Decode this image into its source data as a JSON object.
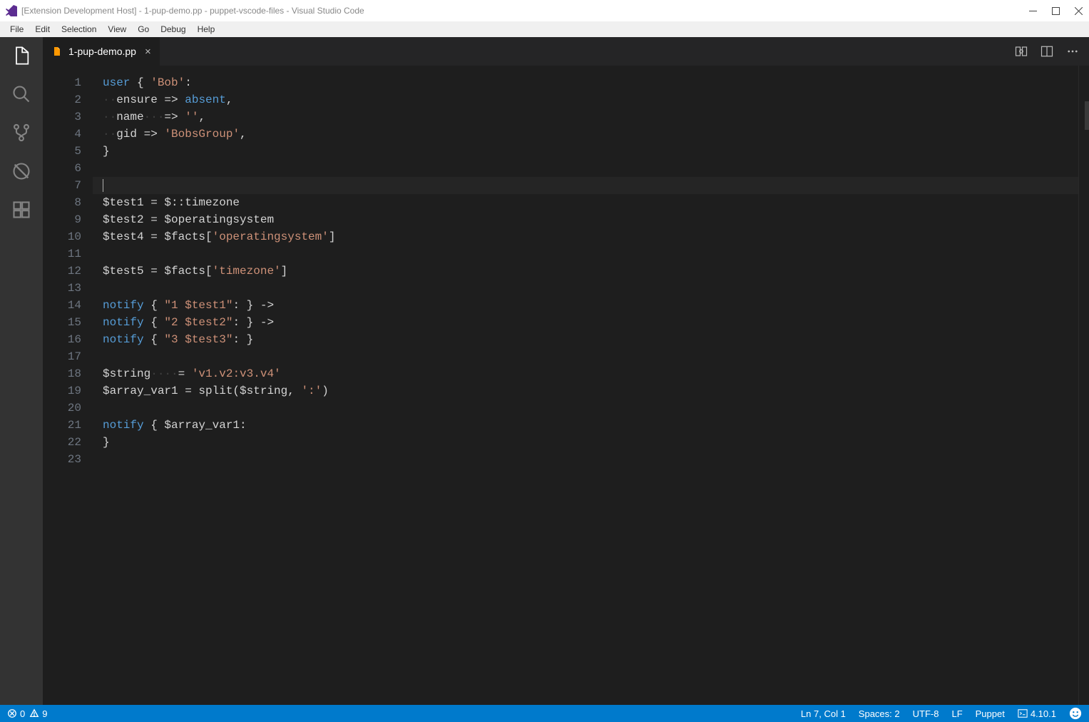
{
  "titlebar": {
    "text": "[Extension Development Host] - 1-pup-demo.pp - puppet-vscode-files - Visual Studio Code"
  },
  "menubar": {
    "items": [
      "File",
      "Edit",
      "Selection",
      "View",
      "Go",
      "Debug",
      "Help"
    ]
  },
  "activitybar": {
    "icons": [
      "files-icon",
      "search-icon",
      "source-control-icon",
      "debug-icon",
      "extensions-icon"
    ]
  },
  "tab": {
    "filename": "1-pup-demo.pp"
  },
  "editor": {
    "line_count": 23,
    "current_line": 7,
    "lines": [
      {
        "n": 1,
        "segments": [
          {
            "t": "user",
            "c": "kw"
          },
          {
            "t": " { ",
            "c": "op"
          },
          {
            "t": "'Bob'",
            "c": "str"
          },
          {
            "t": ":",
            "c": "op"
          }
        ]
      },
      {
        "n": 2,
        "segments": [
          {
            "t": "··",
            "c": "ws"
          },
          {
            "t": "ensure ",
            "c": "var"
          },
          {
            "t": "=>",
            "c": "op"
          },
          {
            "t": " ",
            "c": "op"
          },
          {
            "t": "absent",
            "c": "kw"
          },
          {
            "t": ",",
            "c": "op"
          }
        ]
      },
      {
        "n": 3,
        "segments": [
          {
            "t": "··",
            "c": "ws"
          },
          {
            "t": "name",
            "c": "var"
          },
          {
            "t": "···",
            "c": "ws"
          },
          {
            "t": "=>",
            "c": "op"
          },
          {
            "t": " ",
            "c": "op"
          },
          {
            "t": "''",
            "c": "str"
          },
          {
            "t": ",",
            "c": "op"
          }
        ]
      },
      {
        "n": 4,
        "segments": [
          {
            "t": "··",
            "c": "ws"
          },
          {
            "t": "gid ",
            "c": "var"
          },
          {
            "t": "=>",
            "c": "op"
          },
          {
            "t": " ",
            "c": "op"
          },
          {
            "t": "'BobsGroup'",
            "c": "str"
          },
          {
            "t": ",",
            "c": "op"
          }
        ]
      },
      {
        "n": 5,
        "segments": [
          {
            "t": "}",
            "c": "op"
          }
        ]
      },
      {
        "n": 6,
        "segments": []
      },
      {
        "n": 7,
        "segments": []
      },
      {
        "n": 8,
        "segments": [
          {
            "t": "$test1 = $::timezone",
            "c": "var"
          }
        ]
      },
      {
        "n": 9,
        "segments": [
          {
            "t": "$test2 = $operatingsystem",
            "c": "var"
          }
        ]
      },
      {
        "n": 10,
        "segments": [
          {
            "t": "$test4 = $facts[",
            "c": "var"
          },
          {
            "t": "'operatingsystem'",
            "c": "str"
          },
          {
            "t": "]",
            "c": "var"
          }
        ]
      },
      {
        "n": 11,
        "segments": []
      },
      {
        "n": 12,
        "segments": [
          {
            "t": "$test5 = $facts[",
            "c": "var"
          },
          {
            "t": "'timezone'",
            "c": "str"
          },
          {
            "t": "]",
            "c": "var"
          }
        ]
      },
      {
        "n": 13,
        "segments": []
      },
      {
        "n": 14,
        "segments": [
          {
            "t": "notify",
            "c": "kw"
          },
          {
            "t": " { ",
            "c": "op"
          },
          {
            "t": "\"1 $test1\"",
            "c": "str"
          },
          {
            "t": ": } ->",
            "c": "op"
          }
        ]
      },
      {
        "n": 15,
        "segments": [
          {
            "t": "notify",
            "c": "kw"
          },
          {
            "t": " { ",
            "c": "op"
          },
          {
            "t": "\"2 $test2\"",
            "c": "str"
          },
          {
            "t": ": } ->",
            "c": "op"
          }
        ]
      },
      {
        "n": 16,
        "segments": [
          {
            "t": "notify",
            "c": "kw"
          },
          {
            "t": " { ",
            "c": "op"
          },
          {
            "t": "\"3 $test3\"",
            "c": "str"
          },
          {
            "t": ": }",
            "c": "op"
          }
        ]
      },
      {
        "n": 17,
        "segments": []
      },
      {
        "n": 18,
        "segments": [
          {
            "t": "$string",
            "c": "var"
          },
          {
            "t": "····",
            "c": "ws"
          },
          {
            "t": "= ",
            "c": "op"
          },
          {
            "t": "'v1.v2:v3.v4'",
            "c": "str"
          }
        ]
      },
      {
        "n": 19,
        "segments": [
          {
            "t": "$array_var1 = split($string, ",
            "c": "var"
          },
          {
            "t": "':'",
            "c": "str"
          },
          {
            "t": ")",
            "c": "var"
          }
        ]
      },
      {
        "n": 20,
        "segments": []
      },
      {
        "n": 21,
        "segments": [
          {
            "t": "notify",
            "c": "kw"
          },
          {
            "t": " { $array_var1:",
            "c": "var"
          }
        ]
      },
      {
        "n": 22,
        "segments": [
          {
            "t": "}",
            "c": "op"
          }
        ]
      },
      {
        "n": 23,
        "segments": []
      }
    ]
  },
  "statusbar": {
    "errors": "0",
    "warnings": "9",
    "cursor": "Ln 7, Col 1",
    "spaces": "Spaces: 2",
    "encoding": "UTF-8",
    "eol": "LF",
    "language": "Puppet",
    "server_version": "4.10.1"
  }
}
